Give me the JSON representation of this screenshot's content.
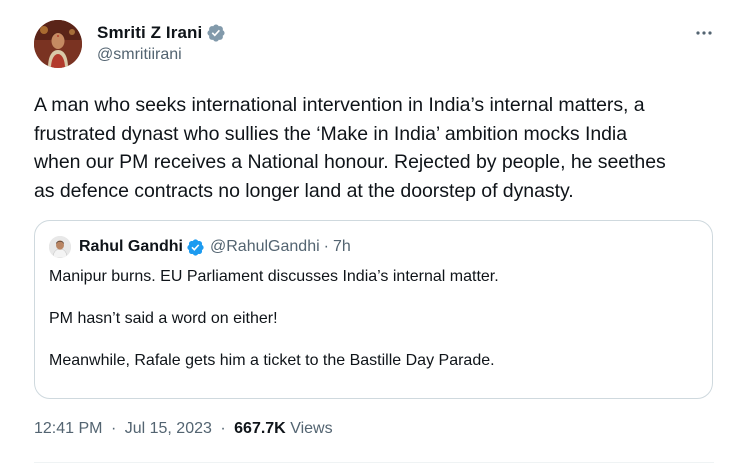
{
  "author": {
    "name": "Smriti Z Irani",
    "handle": "@smritiirani",
    "verified_icon": "verified-badge-icon",
    "avatar_icon": "profile-photo"
  },
  "menu_icon": "more-options-icon",
  "tweet": {
    "text": "A man who seeks international intervention in India’s internal matters, a\nfrustrated dynast who sullies the ‘Make in India’ ambition mocks India\nwhen our PM receives a National honour. Rejected by people, he seethes\nas defence contracts no longer land at the doorstep of dynasty."
  },
  "quote": {
    "name": "Rahul Gandhi",
    "handle": "@RahulGandhi",
    "separator": "·",
    "time": "7h",
    "lines": [
      "Manipur burns. EU Parliament discusses India’s internal matter.",
      "PM hasn’t said a word on either!",
      "Meanwhile, Rafale gets him a ticket to the Bastille Day Parade."
    ]
  },
  "footer": {
    "time": "12:41 PM",
    "sep1": "·",
    "date": "Jul 15, 2023",
    "sep2": "·",
    "views_count": "667.7K",
    "views_label": "Views"
  },
  "colors": {
    "verified": "#1d9bf0",
    "secondary_text": "#536471",
    "border": "#cfd9de"
  }
}
